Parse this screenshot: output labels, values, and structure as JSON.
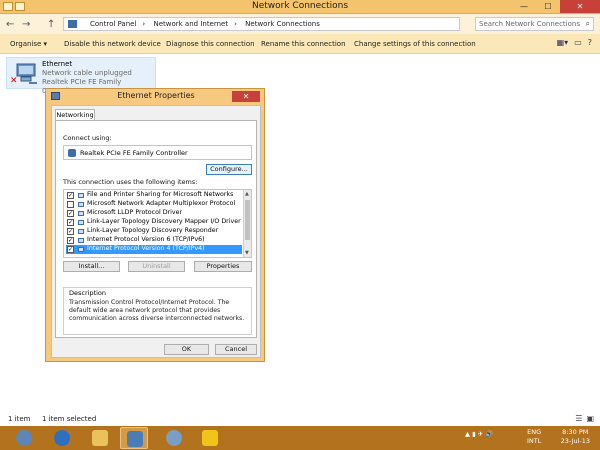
{
  "window": {
    "title": "Network Connections",
    "minimize": "—",
    "maximize": "☐",
    "close": "✕"
  },
  "address": {
    "back": "←",
    "forward": "→",
    "up": "↑",
    "path": [
      "Control Panel",
      "Network and Internet",
      "Network Connections"
    ],
    "search_placeholder": "Search Network Connections"
  },
  "commands": {
    "organise": "Organise ▾",
    "disable": "Disable this network device",
    "diagnose": "Diagnose this connection",
    "rename": "Rename this connection",
    "change": "Change settings of this connection"
  },
  "adapter": {
    "name": "Ethernet",
    "status": "Network cable unplugged",
    "device": "Realtek PCIe FE Family Controller"
  },
  "dialog": {
    "title": "Ethernet Properties",
    "close": "✕",
    "tab": "Networking",
    "connect_using_label": "Connect using:",
    "adapter_name": "Realtek PCIe FE Family Controller",
    "configure": "Configure...",
    "items_label": "This connection uses the following items:",
    "items": [
      {
        "label": "File and Printer Sharing for Microsoft Networks",
        "checked": true
      },
      {
        "label": "Microsoft Network Adapter Multiplexor Protocol",
        "checked": false
      },
      {
        "label": "Microsoft LLDP Protocol Driver",
        "checked": true
      },
      {
        "label": "Link-Layer Topology Discovery Mapper I/O Driver",
        "checked": true
      },
      {
        "label": "Link-Layer Topology Discovery Responder",
        "checked": true
      },
      {
        "label": "Internet Protocol Version 6 (TCP/IPv6)",
        "checked": true
      },
      {
        "label": "Internet Protocol Version 4 (TCP/IPv4)",
        "checked": true,
        "selected": true
      }
    ],
    "install": "Install...",
    "uninstall": "Uninstall",
    "properties": "Properties",
    "description_label": "Description",
    "description": "Transmission Control Protocol/Internet Protocol. The default wide area network protocol that provides communication across diverse interconnected networks.",
    "ok": "OK",
    "cancel": "Cancel"
  },
  "status": {
    "items": "1 item",
    "selected": "1 item selected"
  },
  "taskbar": {
    "lang": "ENG",
    "region": "INTL",
    "time": "8:30 PM",
    "date": "23-Jul-13"
  }
}
